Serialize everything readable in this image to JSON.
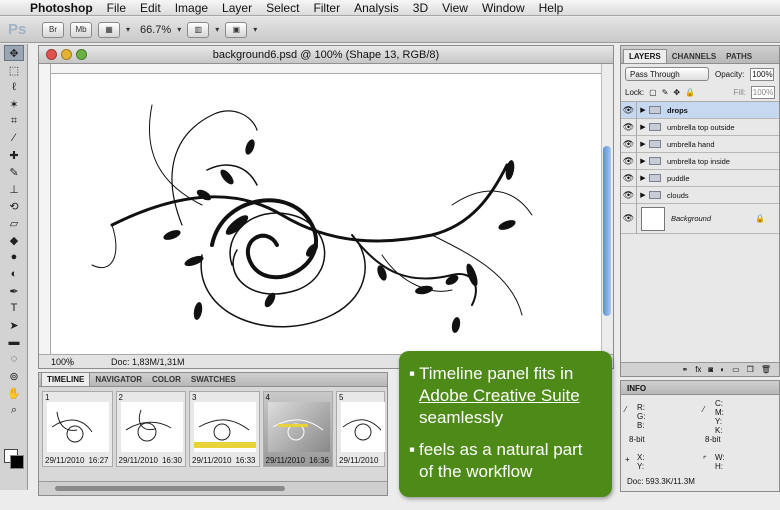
{
  "menubar": {
    "app": "Photoshop",
    "items": [
      "File",
      "Edit",
      "Image",
      "Layer",
      "Select",
      "Filter",
      "Analysis",
      "3D",
      "View",
      "Window",
      "Help"
    ]
  },
  "optbar": {
    "ps": "Ps",
    "br": "Br",
    "mb": "Mb",
    "zoom": "66.7%"
  },
  "document": {
    "title": "background6.psd @ 100% (Shape 13, RGB/8)",
    "status_zoom": "100%",
    "status_doc": "Doc: 1,83M/1,31M"
  },
  "timeline": {
    "tabs": [
      "TIMELINE",
      "NAVIGATOR",
      "COLOR",
      "SWATCHES"
    ],
    "frames": [
      {
        "num": "1",
        "date": "29/11/2010",
        "time": "16:27"
      },
      {
        "num": "2",
        "date": "29/11/2010",
        "time": "16:30"
      },
      {
        "num": "3",
        "date": "29/11/2010",
        "time": "16:33"
      },
      {
        "num": "4",
        "date": "29/11/2010",
        "time": "16:36"
      },
      {
        "num": "5",
        "date": "29/11/2010",
        "time": ""
      }
    ]
  },
  "layers": {
    "tabs": [
      "LAYERS",
      "CHANNELS",
      "PATHS"
    ],
    "blend": "Pass Through",
    "opacity_label": "Opacity:",
    "opacity": "100%",
    "lock_label": "Lock:",
    "fill_label": "Fill:",
    "fill": "100%",
    "items": [
      "drops",
      "umbrella top outside",
      "umbrella hand",
      "umbrella top inside",
      "puddle",
      "clouds"
    ],
    "background": "Background"
  },
  "info": {
    "title": "INFO",
    "rgb": [
      "R:",
      "G:",
      "B:"
    ],
    "cmyk": [
      "C:",
      "M:",
      "Y:",
      "K:"
    ],
    "bit1": "8-bit",
    "bit2": "8-bit",
    "xy": [
      "X:",
      "Y:"
    ],
    "wh": [
      "W:",
      "H:"
    ],
    "doc": "Doc: 593.3K/11.3M"
  },
  "callout": {
    "b1_line1": "Timeline panel fits in",
    "b1_line2": "Adobe Creative Suite",
    "b1_line3": "seamlessly",
    "b2_line1": "feels as a natural part",
    "b2_line2": "of the workflow"
  },
  "colors": {
    "callout": "#4d8a17",
    "selected_layer": "#c5d8f0",
    "scroll_thumb": "#5b8fd3"
  },
  "icons": [
    "apple-icon",
    "eye-icon",
    "folder-icon",
    "lock-icon",
    "close-icon"
  ]
}
